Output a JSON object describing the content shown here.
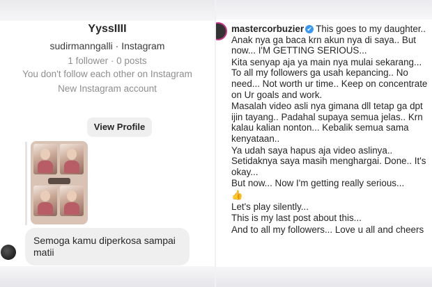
{
  "profile": {
    "name": "YyssIIII",
    "handle": "sudirmanngalli · Instagram",
    "stats": "1 follower · 0 posts",
    "follow_status": "You don't follow each other on Instagram",
    "account_note": "New Instagram account",
    "view_profile_label": "View Profile"
  },
  "message": {
    "text": "Semoga kamu diperkosa sampai matii"
  },
  "post": {
    "username": "mastercorbuzier",
    "verified_glyph": "✔",
    "caption_paragraphs": [
      "This goes to my daughter.. Anak nya ga baca krn akun nya di saya.. But now... I'M GETTING SERIOUS...",
      "Kita senyap aja ya main nya mulai sekarang... To all my followers ga usah kepancing.. No need... Not worth ur time.. Keep on concentrate on Ur goals and work.",
      "Masalah video asli nya gimana dll tetap ga dpt ijin tayang.. Padahal supaya semua jelas.. Krn kalau kalian nonton... Kebalik semua sama kenyataan..",
      "Ya udah saya hapus aja video aslinya.. Setidaknya saya masih menghargai. Done.. It's okay...",
      "But now... Now I'm getting really serious...",
      "👍",
      "Let's play silently...",
      "This is my last post about this...",
      "And to all my followers... Love u all and cheers"
    ]
  },
  "colors": {
    "text_primary": "#262626",
    "text_secondary": "#8e8e8e",
    "button_bg": "#efefef",
    "verified_blue": "#3897f0"
  }
}
